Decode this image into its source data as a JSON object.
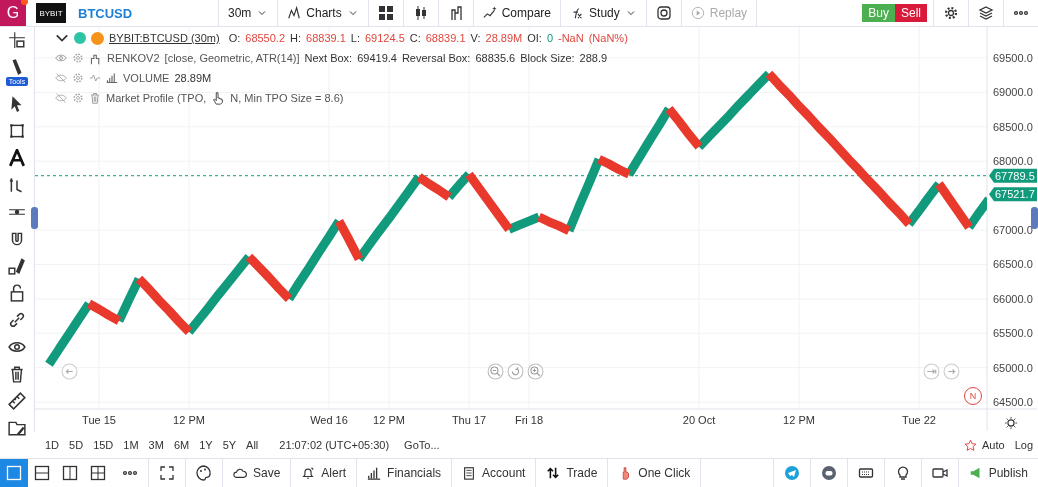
{
  "top_bar": {
    "avatar": "G",
    "exchange_logo": "BYBIT",
    "symbol": "BTCUSD",
    "interval": "30m",
    "charts": "Charts",
    "compare": "Compare",
    "study": "Study",
    "replay": "Replay",
    "buy": "Buy",
    "sell": "Sell"
  },
  "left_toolbar": {
    "tools_badge": "Tools"
  },
  "legend": {
    "symbol": "BYBIT:BTCUSD (30m)",
    "ohlc": [
      {
        "label": "O:",
        "value": "68550.2"
      },
      {
        "label": "H:",
        "value": "68839.1"
      },
      {
        "label": "L:",
        "value": "69124.5"
      },
      {
        "label": "C:",
        "value": "68839.1"
      },
      {
        "label": "V:",
        "value": "28.89M"
      },
      {
        "label": "OI:",
        "value": "0"
      }
    ],
    "change": "-NaN",
    "change_pct": "(NaN%)"
  },
  "studies": [
    {
      "kind": "renko",
      "hidden": false,
      "name": "RENKOV2",
      "params": "[close, Geometric, ATR(14)]",
      "readouts": [
        {
          "label": "Next Box:",
          "value": "69419.4"
        },
        {
          "label": "Reversal Box:",
          "value": "68835.6"
        },
        {
          "label": "Block Size:",
          "value": "288.9"
        }
      ]
    },
    {
      "kind": "volume",
      "hidden": true,
      "name": "VOLUME",
      "value": "28.89M"
    },
    {
      "kind": "profile",
      "hidden": true,
      "name": "Market Profile (TPO,",
      "tail": "N, Min TPO Size = 8.6)"
    }
  ],
  "chart": {
    "chart_data": {
      "type": "line",
      "categories": [
        null,
        null,
        null,
        null,
        null,
        "Tue 15",
        null,
        null,
        null,
        null,
        null,
        null,
        null,
        null,
        "12 PM",
        null,
        null,
        null,
        null,
        null,
        null,
        null,
        null,
        null,
        null,
        null,
        null,
        null,
        "Wed 16",
        null,
        null,
        null,
        null,
        null,
        "12 PM",
        null,
        null,
        null,
        null,
        null,
        null,
        null,
        "Thu 17",
        null,
        null,
        null,
        null,
        null,
        "Fri 18",
        null,
        null,
        null,
        null,
        null,
        null,
        null,
        null,
        null,
        null,
        null,
        null,
        null,
        null,
        null,
        null,
        "20 Oct",
        null,
        null,
        null,
        null,
        null,
        null,
        null,
        null,
        null,
        "12 PM",
        null,
        null,
        null,
        null,
        null,
        null,
        null,
        null,
        null,
        null,
        null,
        "Tue 22",
        null,
        null,
        null,
        null,
        null,
        null,
        null
      ],
      "series": [
        {
          "color": "#129a7c",
          "values": [
            65050,
            65270,
            65490,
            65710,
            65930,
            null,
            null,
            65680,
            65990,
            66290,
            null,
            null,
            null,
            null,
            65520,
            65700,
            65880,
            66070,
            66250,
            66430,
            66610,
            null,
            null,
            null,
            66000,
            66230,
            66450,
            66680,
            66900,
            67130,
            null,
            66580,
            66780,
            66980,
            67170,
            67370,
            67570,
            67770,
            null,
            null,
            67480,
            67650,
            67810,
            null,
            null,
            null,
            67010,
            67070,
            67130,
            67190,
            null,
            null,
            66990,
            67340,
            67680,
            68030,
            null,
            null,
            67810,
            68050,
            68290,
            68520,
            68760,
            null,
            null,
            68210,
            68360,
            68510,
            68660,
            68820,
            68970,
            69120,
            69270,
            null,
            null,
            null,
            null,
            null,
            null,
            null,
            null,
            null,
            null,
            null,
            null,
            null,
            67090,
            67280,
            67480,
            67670,
            null,
            null,
            67040,
            67250,
            67450
          ]
        },
        {
          "color": "#e8392c",
          "values": [
            null,
            null,
            null,
            null,
            65930,
            65850,
            65760,
            65680,
            null,
            66290,
            66140,
            65980,
            65830,
            65670,
            65520,
            null,
            null,
            null,
            null,
            null,
            66610,
            66460,
            66310,
            66150,
            66000,
            null,
            null,
            null,
            null,
            67130,
            66860,
            66580,
            null,
            null,
            null,
            null,
            null,
            67770,
            67670,
            67580,
            67480,
            null,
            67810,
            67610,
            67410,
            67210,
            67010,
            null,
            null,
            67190,
            67120,
            67060,
            66990,
            null,
            null,
            68030,
            67960,
            67880,
            67810,
            null,
            null,
            null,
            68760,
            68580,
            68390,
            68210,
            null,
            null,
            null,
            null,
            null,
            null,
            69270,
            69110,
            68960,
            68800,
            68650,
            68490,
            68340,
            68180,
            68020,
            67870,
            67710,
            67560,
            67400,
            67250,
            67090,
            null,
            null,
            67670,
            67460,
            67250,
            67040,
            null,
            null
          ]
        }
      ],
      "ylim": [
        64400,
        69950
      ],
      "grid": true,
      "ref_lines": [
        {
          "axis": "y",
          "value": 67789.5,
          "label": "67789.5",
          "color": "#129a7c"
        }
      ],
      "yticks": [
        {
          "value": 69500,
          "label": "69500.0"
        },
        {
          "value": 69000,
          "label": "69000.0"
        },
        {
          "value": 68500,
          "label": "68500.0"
        },
        {
          "value": 68000,
          "label": "68000.0"
        },
        {
          "value": 67000,
          "label": "67000.0"
        },
        {
          "value": 66500,
          "label": "66500.0"
        },
        {
          "value": 66000,
          "label": "66000.0"
        },
        {
          "value": 65500,
          "label": "65500.0"
        },
        {
          "value": 65000,
          "label": "65000.0"
        },
        {
          "value": 64500,
          "label": "64500.0"
        }
      ]
    },
    "price_tags": [
      {
        "value": "67521.7"
      }
    ],
    "news_badge": "N"
  },
  "range_bar": {
    "ranges": [
      "1D",
      "5D",
      "15D",
      "1M",
      "3M",
      "6M",
      "1Y",
      "5Y",
      "All"
    ],
    "clock": "21:07:02 (UTC+05:30)",
    "goto": "GoTo...",
    "auto": "Auto",
    "log": "Log"
  },
  "bottom_bar": {
    "layouts": [
      {
        "kind": "single",
        "selected": true
      },
      {
        "kind": "rows",
        "selected": false
      },
      {
        "kind": "cols",
        "selected": false
      },
      {
        "kind": "grid",
        "selected": false
      }
    ],
    "buttons": [
      {
        "kind": "save",
        "label": "Save"
      },
      {
        "kind": "alert",
        "label": "Alert"
      },
      {
        "kind": "financials",
        "label": "Financials"
      },
      {
        "kind": "account",
        "label": "Account"
      },
      {
        "kind": "trade",
        "label": "Trade"
      },
      {
        "kind": "oneclick",
        "label": "One Click"
      }
    ],
    "publish": "Publish"
  }
}
